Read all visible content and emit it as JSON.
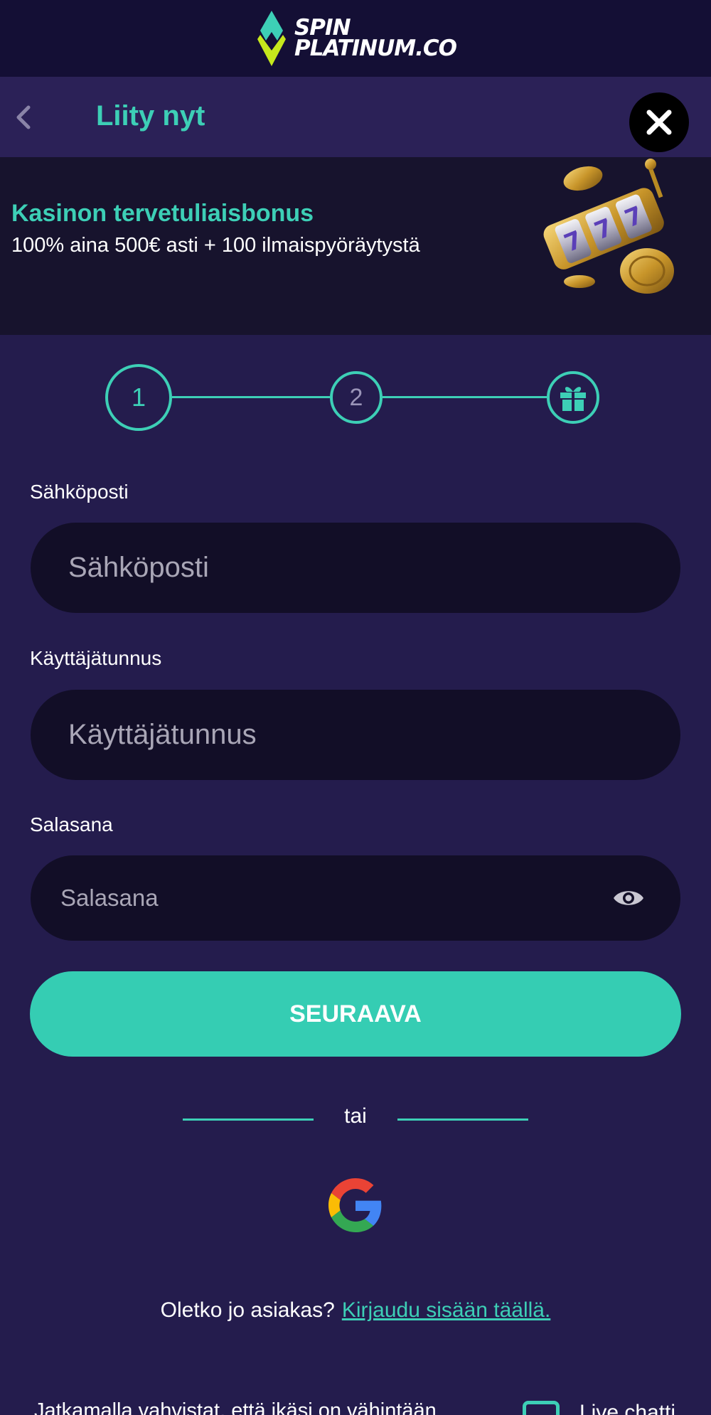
{
  "brand": {
    "line1": "SPIN",
    "line2": "PLATINUM.CO",
    "colors": {
      "mark_top": "#3dcfb6",
      "mark_bottom": "#c6e81c"
    }
  },
  "header": {
    "title": "Liity nyt",
    "back_icon": "chevron-left-icon",
    "close_icon": "close-icon"
  },
  "banner": {
    "title": "Kasinon tervetuliaisbonus",
    "subtitle": "100% aina 500€ asti + 100 ilmaispyöräytystä",
    "art_icon": "slot-machine-coins-illustration"
  },
  "stepper": {
    "steps": [
      {
        "label": "1",
        "state": "active"
      },
      {
        "label": "2",
        "state": "pending"
      },
      {
        "label": "",
        "icon": "gift-icon",
        "state": "pending"
      }
    ]
  },
  "form": {
    "email": {
      "label": "Sähköposti",
      "placeholder": "Sähköposti",
      "value": ""
    },
    "username": {
      "label": "Käyttäjätunnus",
      "placeholder": "Käyttäjätunnus",
      "value": ""
    },
    "password": {
      "label": "Salasana",
      "placeholder": "Salasana",
      "value": "",
      "toggle_icon": "eye-icon"
    },
    "submit_label": "SEURAAVA"
  },
  "divider": {
    "text": "tai"
  },
  "social": {
    "google_icon": "google-icon"
  },
  "login": {
    "prompt": "Oletko jo asiakas?",
    "link": "Kirjaudu sisään täällä."
  },
  "footer": {
    "consent_text": "Jatkamalla vahvistat, että ikäsi on vähintään",
    "live_chat": "Live chatti"
  },
  "colors": {
    "accent": "#3dcfb6",
    "button": "#35cdb3",
    "background": "#241c4d",
    "header_bg": "#2b2157",
    "banner_bg": "#17132d",
    "topbar_bg": "#140f35",
    "input_bg": "#120e27"
  }
}
